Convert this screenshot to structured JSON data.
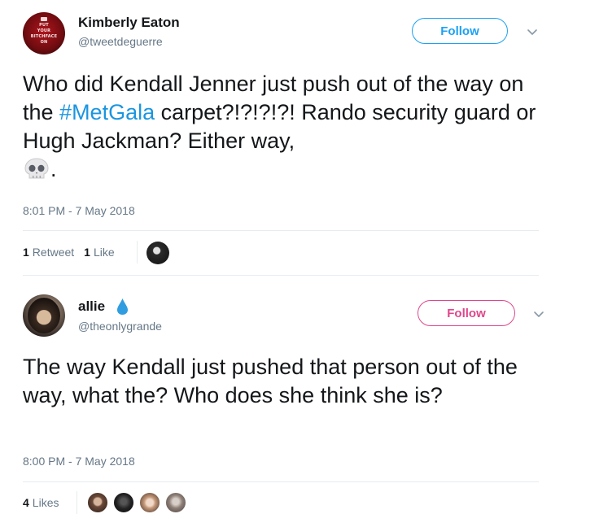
{
  "tweet1": {
    "author_name": "Kimberly Eaton",
    "author_handle": "@tweetdeguerre",
    "avatar_text": [
      "PUT",
      "YOUR",
      "BITCHFACE",
      "ON"
    ],
    "follow_label": "Follow",
    "text_before": "Who did Kendall Jenner just push out of the way on the ",
    "hashtag": "#MetGala",
    "text_after": " carpet?!?!?!?! Rando security guard or Hugh Jackman? Either way,",
    "emoji": "💀",
    "text_end": ".",
    "timestamp": "8:01 PM - 7 May 2018",
    "retweets_count": "1",
    "retweets_label": "Retweet",
    "likes_count": "1",
    "likes_label": "Like"
  },
  "tweet2": {
    "author_name": "allie",
    "author_handle": "@theonlygrande",
    "follow_label": "Follow",
    "text": "The way Kendall just pushed that person out of the way, what the? Who does she think she is?",
    "timestamp": "8:00 PM - 7 May 2018",
    "likes_count": "4",
    "likes_label": "Likes"
  },
  "colors": {
    "follow_blue": "#1da1f2",
    "follow_pink": "#e0468c",
    "hashtag": "#1b95e0",
    "muted_text": "#657786",
    "verified_drop": "#2f9de0"
  }
}
